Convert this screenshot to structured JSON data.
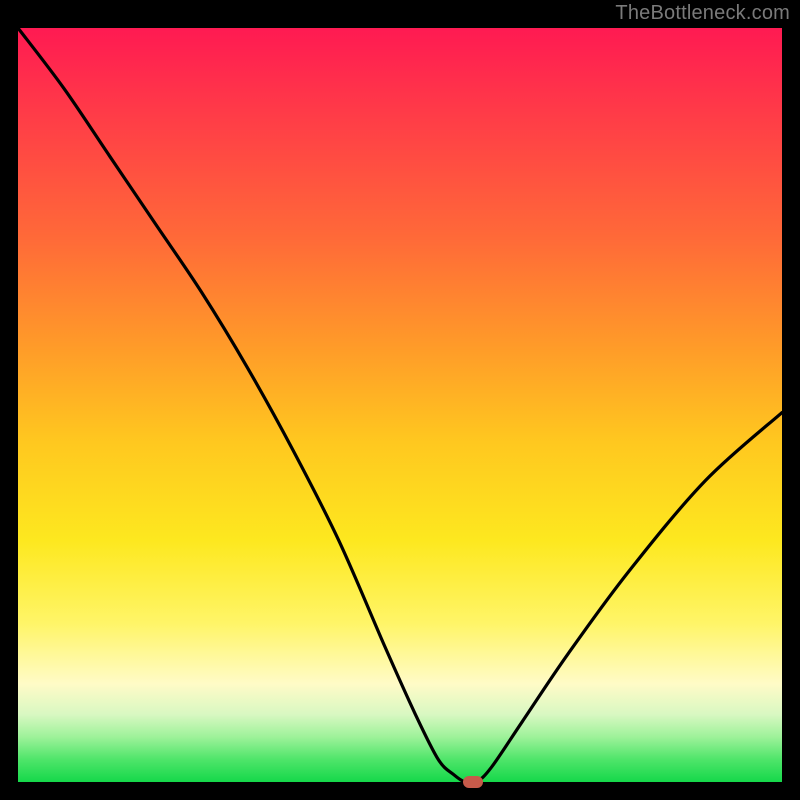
{
  "watermark": "TheBottleneck.com",
  "colors": {
    "frame_bg": "#000000",
    "watermark_text": "#7a7a7a",
    "curve_stroke": "#000000",
    "marker_fill": "#c65a4a",
    "gradient_stops": [
      {
        "pos": 0.0,
        "color": "#ff1a52"
      },
      {
        "pos": 0.12,
        "color": "#ff3d47"
      },
      {
        "pos": 0.28,
        "color": "#ff6a38"
      },
      {
        "pos": 0.42,
        "color": "#ff9a29"
      },
      {
        "pos": 0.55,
        "color": "#ffc81f"
      },
      {
        "pos": 0.68,
        "color": "#fde81f"
      },
      {
        "pos": 0.79,
        "color": "#fff568"
      },
      {
        "pos": 0.87,
        "color": "#fffbc7"
      },
      {
        "pos": 0.91,
        "color": "#d9f8c2"
      },
      {
        "pos": 0.94,
        "color": "#9ef29a"
      },
      {
        "pos": 0.97,
        "color": "#4fe56a"
      },
      {
        "pos": 1.0,
        "color": "#15d84a"
      }
    ]
  },
  "chart_data": {
    "type": "line",
    "title": "",
    "xlabel": "",
    "ylabel": "",
    "xlim": [
      0,
      100
    ],
    "ylim": [
      0,
      100
    ],
    "series": [
      {
        "name": "bottleneck-curve",
        "x": [
          0,
          6,
          12,
          18,
          24,
          30,
          36,
          42,
          48,
          52,
          55,
          57,
          58.5,
          60,
          62,
          66,
          72,
          80,
          90,
          100
        ],
        "y": [
          100,
          92,
          83,
          74,
          65,
          55,
          44,
          32,
          18,
          9,
          3,
          1,
          0,
          0,
          2,
          8,
          17,
          28,
          40,
          49
        ]
      }
    ],
    "marker": {
      "x": 59.5,
      "y": 0
    },
    "notes": "V-shaped bottleneck curve over a vertical heat gradient. Minimum (optimal / zero-bottleneck point) occurs around x≈59 where the curve touches y=0; values are read off by proportion since axes have no tick labels."
  }
}
